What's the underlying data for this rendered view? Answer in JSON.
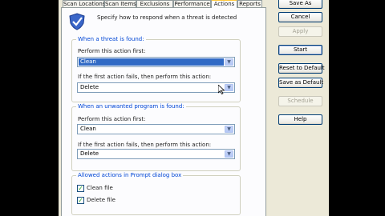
{
  "tabs": [
    {
      "label": "Scan Locations",
      "active": false
    },
    {
      "label": "Scan Items",
      "active": false
    },
    {
      "label": "Exclusions",
      "active": false
    },
    {
      "label": "Performance",
      "active": false
    },
    {
      "label": "Actions",
      "active": true
    },
    {
      "label": "Reports",
      "active": false
    }
  ],
  "header": {
    "icon": "shield-check-icon",
    "text": "Specify how to respond when a threat is detected"
  },
  "threat_group": {
    "title": "When a threat is found:",
    "first_label": "Perform this action first:",
    "first_value": "Clean",
    "fail_label": "If the first action fails, then perform this action:",
    "fail_value": "Delete"
  },
  "unwanted_group": {
    "title": "When an unwanted program is found:",
    "first_label": "Perform this action first:",
    "first_value": "Clean",
    "fail_label": "If the first action fails, then perform this action:",
    "fail_value": "Delete"
  },
  "prompt_group": {
    "title": "Allowed actions in Prompt dialog box",
    "items": [
      {
        "label": "Clean file",
        "checked": true
      },
      {
        "label": "Delete file",
        "checked": true
      }
    ]
  },
  "buttons": {
    "save_as": "Save As",
    "cancel": "Cancel",
    "apply": "Apply",
    "start": "Start",
    "reset": "Reset to Default",
    "save_default": "Save as Default",
    "schedule": "Schedule",
    "help": "Help"
  },
  "colors": {
    "group_title": "#0046d5",
    "selection": "#316ac5",
    "active_tab_top": "#ffc83c"
  }
}
